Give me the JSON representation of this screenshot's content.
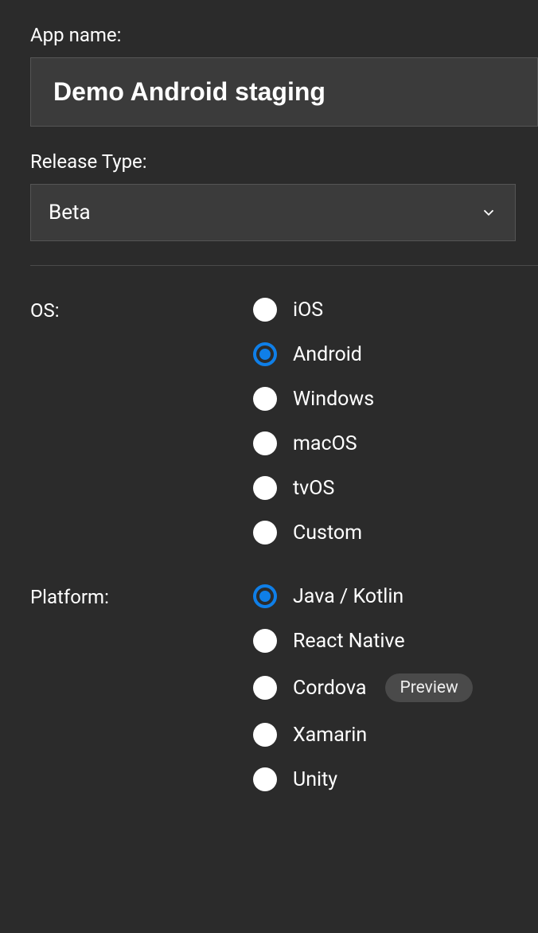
{
  "app_name": {
    "label": "App name:",
    "value": "Demo Android staging"
  },
  "release_type": {
    "label": "Release Type:",
    "selected": "Beta"
  },
  "os": {
    "label": "OS:",
    "options": [
      {
        "label": "iOS",
        "selected": false
      },
      {
        "label": "Android",
        "selected": true
      },
      {
        "label": "Windows",
        "selected": false
      },
      {
        "label": "macOS",
        "selected": false
      },
      {
        "label": "tvOS",
        "selected": false
      },
      {
        "label": "Custom",
        "selected": false
      }
    ]
  },
  "platform": {
    "label": "Platform:",
    "options": [
      {
        "label": "Java / Kotlin",
        "selected": true,
        "badge": null
      },
      {
        "label": "React Native",
        "selected": false,
        "badge": null
      },
      {
        "label": "Cordova",
        "selected": false,
        "badge": "Preview"
      },
      {
        "label": "Xamarin",
        "selected": false,
        "badge": null
      },
      {
        "label": "Unity",
        "selected": false,
        "badge": null
      }
    ]
  }
}
